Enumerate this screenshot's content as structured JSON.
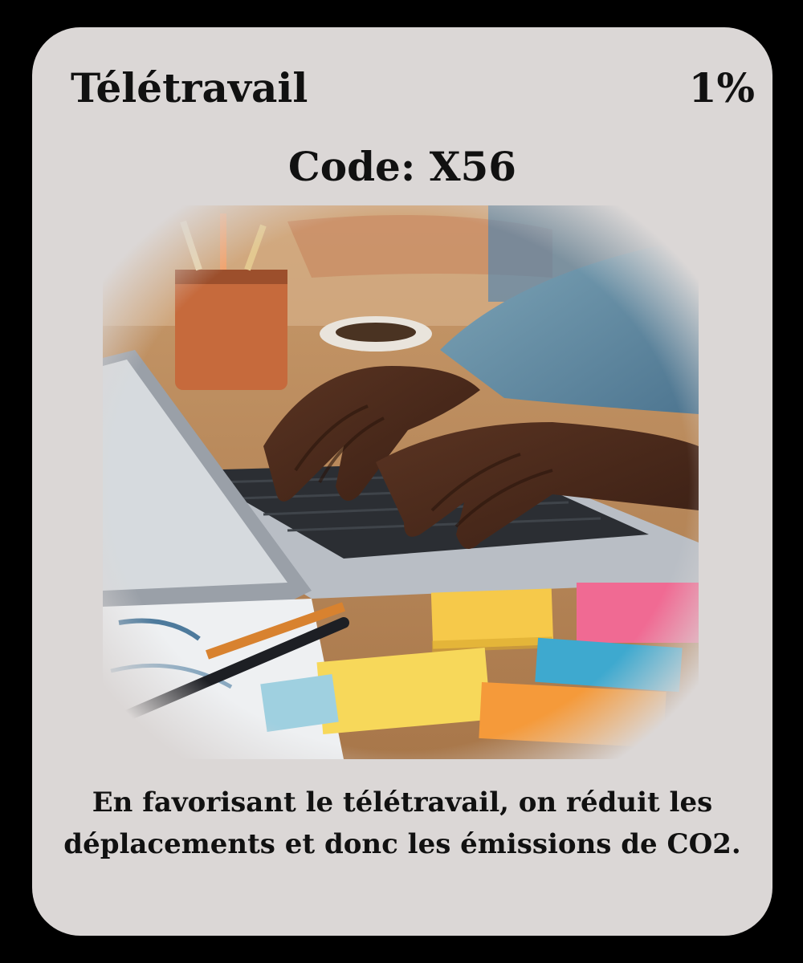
{
  "card": {
    "title": "Télétravail",
    "percent": "1%",
    "code": "Code: X56",
    "caption": "En favorisant le télétravail, on réduit les déplacements et donc les émissions de CO2.",
    "image_alt": "Mains tapant sur un clavier d'ordinateur portable entouré de notes adhésives colorées",
    "colors": {
      "background": "#000000",
      "card": "#dbd7d6",
      "text": "#111111"
    }
  }
}
